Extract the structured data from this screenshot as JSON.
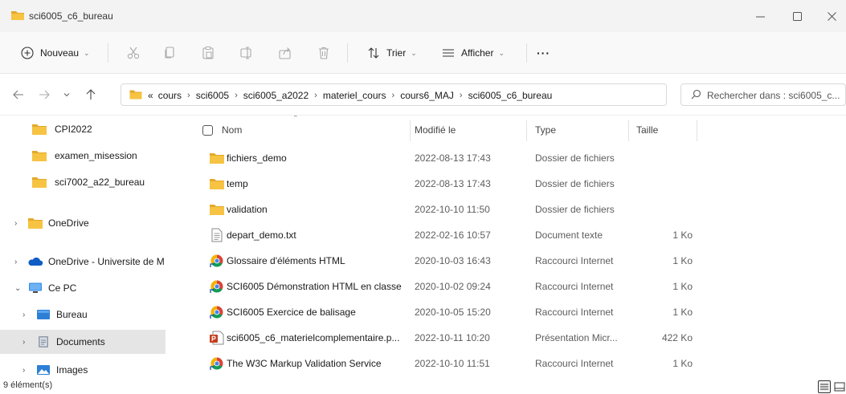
{
  "window": {
    "title": "sci6005_c6_bureau"
  },
  "toolbar": {
    "new_label": "Nouveau",
    "sort_label": "Trier",
    "view_label": "Afficher",
    "more_label": "···"
  },
  "address": {
    "prefix": "«",
    "crumbs": [
      "cours",
      "sci6005",
      "sci6005_a2022",
      "materiel_cours",
      "cours6_MAJ",
      "sci6005_c6_bureau"
    ],
    "search_placeholder": "Rechercher dans : sci6005_c..."
  },
  "sidebar": {
    "items": [
      {
        "label": "CPI2022",
        "icon": "folder-icon",
        "chevron": ""
      },
      {
        "label": "examen_misession",
        "icon": "folder-icon",
        "chevron": ""
      },
      {
        "label": "sci7002_a22_bureau",
        "icon": "folder-icon",
        "chevron": ""
      },
      {
        "label": "OneDrive",
        "icon": "folder-icon",
        "chevron": ">"
      },
      {
        "label": "OneDrive - Universite de M",
        "icon": "cloud-icon",
        "chevron": ">"
      },
      {
        "label": "Ce PC",
        "icon": "computer-icon",
        "chevron": "v"
      },
      {
        "label": "Bureau",
        "icon": "desktop-icon",
        "chevron": ">"
      },
      {
        "label": "Documents",
        "icon": "documents-icon",
        "chevron": ">"
      },
      {
        "label": "Images",
        "icon": "images-icon",
        "chevron": ">"
      }
    ]
  },
  "columns": {
    "name": "Nom",
    "modified": "Modifié le",
    "type": "Type",
    "size": "Taille"
  },
  "files": [
    {
      "name": "fichiers_demo",
      "modified": "2022-08-13 17:43",
      "type": "Dossier de fichiers",
      "size": "",
      "icon": "folder-icon"
    },
    {
      "name": "temp",
      "modified": "2022-08-13 17:43",
      "type": "Dossier de fichiers",
      "size": "",
      "icon": "folder-icon"
    },
    {
      "name": "validation",
      "modified": "2022-10-10 11:50",
      "type": "Dossier de fichiers",
      "size": "",
      "icon": "folder-icon"
    },
    {
      "name": "depart_demo.txt",
      "modified": "2022-02-16 10:57",
      "type": "Document texte",
      "size": "1 Ko",
      "icon": "text-file-icon"
    },
    {
      "name": "Glossaire d'éléments HTML",
      "modified": "2020-10-03 16:43",
      "type": "Raccourci Internet",
      "size": "1 Ko",
      "icon": "chrome-link-icon"
    },
    {
      "name": "SCI6005 Démonstration HTML en classe",
      "modified": "2020-10-02 09:24",
      "type": "Raccourci Internet",
      "size": "1 Ko",
      "icon": "chrome-link-icon"
    },
    {
      "name": "SCI6005 Exercice de balisage",
      "modified": "2020-10-05 15:20",
      "type": "Raccourci Internet",
      "size": "1 Ko",
      "icon": "chrome-link-icon"
    },
    {
      "name": "sci6005_c6_materielcomplementaire.p...",
      "modified": "2022-10-11 10:20",
      "type": "Présentation Micr...",
      "size": "422 Ko",
      "icon": "powerpoint-icon"
    },
    {
      "name": "The W3C Markup Validation Service",
      "modified": "2022-10-10 11:51",
      "type": "Raccourci Internet",
      "size": "1 Ko",
      "icon": "chrome-link-icon"
    }
  ],
  "status": {
    "count": "9 élément(s)"
  },
  "colors": {
    "folder": "#f6c343",
    "folder_dark": "#e3a92b",
    "selection": "#e5e5e5",
    "onedrive": "#0f5cc4",
    "accent": "#0067c0"
  }
}
